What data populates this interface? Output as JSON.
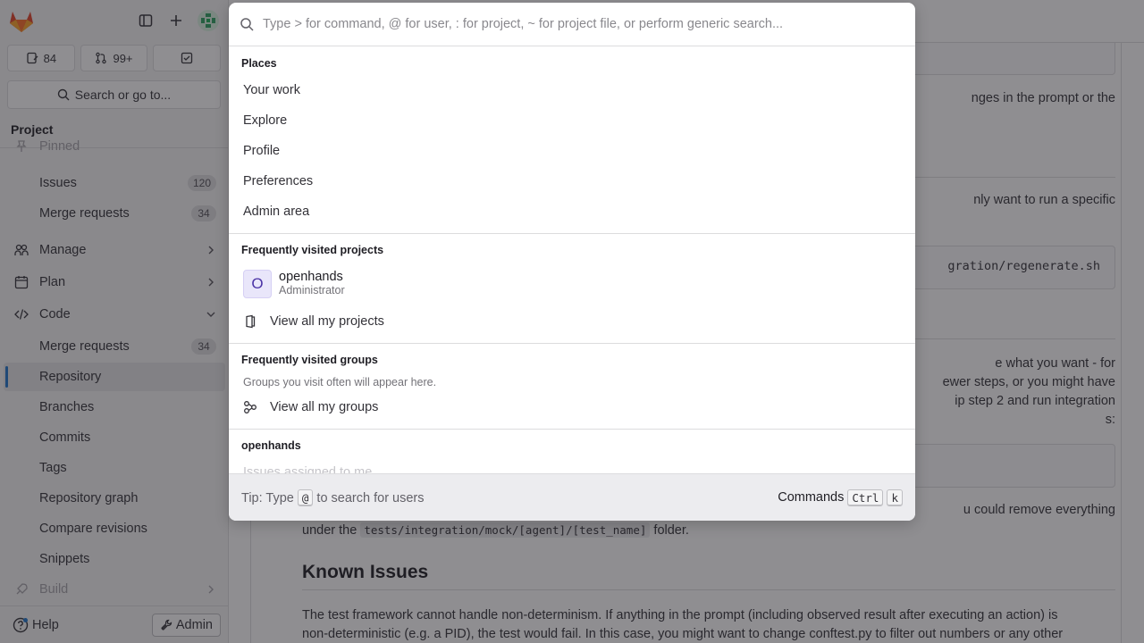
{
  "sidebar": {
    "counts": [
      {
        "icon": "issues-icon",
        "value": "84"
      },
      {
        "icon": "merge-request-icon",
        "value": "99+"
      },
      {
        "icon": "todo-icon",
        "value": ""
      }
    ],
    "search_label": "Search or go to...",
    "section_title": "Project",
    "items": [
      {
        "label": "Pinned"
      },
      {
        "label": "Issues",
        "badge": "120"
      },
      {
        "label": "Merge requests",
        "badge": "34"
      },
      {
        "label": "Manage"
      },
      {
        "label": "Plan"
      },
      {
        "label": "Code"
      },
      {
        "label": "Merge requests",
        "badge": "34"
      },
      {
        "label": "Repository"
      },
      {
        "label": "Branches"
      },
      {
        "label": "Commits"
      },
      {
        "label": "Tags"
      },
      {
        "label": "Repository graph"
      },
      {
        "label": "Compare revisions"
      },
      {
        "label": "Snippets"
      },
      {
        "label": "Build"
      }
    ],
    "help_label": "Help",
    "admin_label": "Admin"
  },
  "main": {
    "para1_tail": "nges in the prompt or the",
    "para2_tail": "nly want to run a specific",
    "code1_tail": "gration/regenerate.sh",
    "para3_lines": [
      "e what you want - for",
      "ewer steps, or you might have",
      "ip step 2 and run integration",
      "s:"
    ],
    "para4_line1": "u could remove everything",
    "para4_line2_pre": "under the ",
    "para4_code": "tests/integration/mock/[agent]/[test_name]",
    "para4_line2_post": " folder.",
    "known_issues_title": "Known Issues",
    "known_issues_line1": "The test framework cannot handle non-determinism. If anything in the prompt (including observed result after executing an action) is",
    "known_issues_line2": "non-deterministic (e.g. a PID), the test would fail. In this case, you might want to change conftest.py to filter out numbers or any other"
  },
  "modal": {
    "search_placeholder": "Type > for command, @ for user, : for project, ~ for project file, or perform generic search...",
    "places_title": "Places",
    "places": [
      "Your work",
      "Explore",
      "Profile",
      "Preferences",
      "Admin area"
    ],
    "projects_title": "Frequently visited projects",
    "project": {
      "initial": "O",
      "name": "openhands",
      "role": "Administrator"
    },
    "view_all_projects": "View all my projects",
    "groups_title": "Frequently visited groups",
    "groups_hint": "Groups you visit often will appear here.",
    "view_all_groups": "View all my groups",
    "context_title": "openhands",
    "context_item": "Issues assigned to me",
    "footer_tip_pre": "Tip: Type ",
    "footer_tip_key": "@",
    "footer_tip_post": " to search for users",
    "commands_label": "Commands",
    "commands_key1": "Ctrl",
    "commands_key2": "k"
  },
  "colors": {
    "accent": "#1f75cb",
    "overlay": "#1f1e24",
    "brand": "#e24329"
  }
}
